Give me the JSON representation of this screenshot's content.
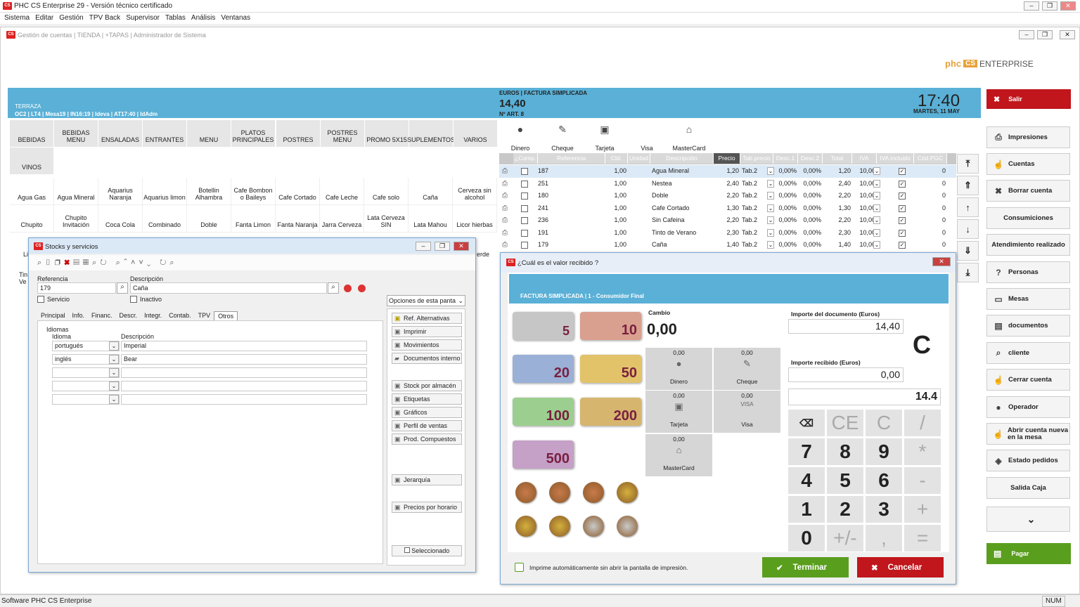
{
  "app": {
    "title": "PHC CS Enterprise 29 - Versión técnico certificado",
    "menu": [
      "Sistema",
      "Editar",
      "Gestión",
      "TPV Back",
      "Supervisor",
      "Tablas",
      "Análisis",
      "Ventanas"
    ],
    "status": "Software PHC CS Enterprise",
    "num": "NUM"
  },
  "inner": {
    "title": "Gestión de cuentas | TIENDA | +TAPAS | Administrador de Sistema",
    "brand": "phc CS ENTERPRISE"
  },
  "header": {
    "area": "TERRAZA",
    "info": "OC2 | LT4 | Mesa19 | IN16:19 | Ideva | AT17:40 | IdAdm",
    "doc": "EUROS | FACTURA SIMPLICADA",
    "total": "14,40",
    "nart": "Nº ART. 8",
    "time": "17:40",
    "date": "MARTES, 11 MAY"
  },
  "categories": [
    "BEBIDAS",
    "BEBIDAS MENU",
    "ENSALADAS",
    "ENTRANTES",
    "MENU",
    "PLATOS PRINCIPALES",
    "POSTRES",
    "POSTRES MENU",
    "PROMO 5X15",
    "SUPLEMENTOS",
    "VARIOS",
    "VINOS"
  ],
  "products": [
    "Agua Gas",
    "Agua Mineral",
    "Aquarius Naranja",
    "Aquarius limon",
    "Botellin Alhambra",
    "Cafe Bombon o Baileys",
    "Cafe Cortado",
    "Cafe Leche",
    "Cafe solo",
    "Caña",
    "Cerveza sin alcohol",
    "Chupito",
    "Chupito Invitación",
    "Coca Cola",
    "Combinado",
    "Doble",
    "Fanta Limon",
    "Fanta Naranja",
    "Jarra Cerveza",
    "Lata Cerveza SIN",
    "Lata Mahou",
    "Licor hierbas"
  ],
  "products_partial": [
    "Li",
    "Tin Ve",
    "erde"
  ],
  "payments": [
    "Dinero",
    "Cheque",
    "Tarjeta",
    "Visa",
    "MasterCard"
  ],
  "table": {
    "headers": [
      "",
      "¿Comp.",
      "Referencia",
      "Ctd.",
      "Unidad",
      "Descripción",
      "Precio",
      "Tab.precio",
      "Desc.1",
      "Desc.2",
      "Total",
      "IVA",
      "IVA incluido",
      "Cód.PGC"
    ],
    "rows": [
      [
        "187",
        "1,00",
        "Agua Mineral",
        "1,20",
        "Tab.2",
        "0,00%",
        "0,00%",
        "1,20",
        "10,00",
        "0"
      ],
      [
        "251",
        "1,00",
        "Nestea",
        "2,40",
        "Tab.2",
        "0,00%",
        "0,00%",
        "2,40",
        "10,00",
        "0"
      ],
      [
        "180",
        "1,00",
        "Doble",
        "2,20",
        "Tab.2",
        "0,00%",
        "0,00%",
        "2,20",
        "10,00",
        "0"
      ],
      [
        "241",
        "1,00",
        "Cafe Cortado",
        "1,30",
        "Tab.2",
        "0,00%",
        "0,00%",
        "1,30",
        "10,00",
        "0"
      ],
      [
        "236",
        "1,00",
        "Sin Cafeina",
        "2,20",
        "Tab.2",
        "0,00%",
        "0,00%",
        "2,20",
        "10,00",
        "0"
      ],
      [
        "191",
        "1,00",
        "Tinto de Verano",
        "2,30",
        "Tab.2",
        "0,00%",
        "0,00%",
        "2,30",
        "10,00",
        "0"
      ],
      [
        "179",
        "1,00",
        "Caña",
        "1,40",
        "Tab.2",
        "0,00%",
        "0,00%",
        "1,40",
        "10,00",
        "0"
      ]
    ]
  },
  "right": {
    "salir": "Salir",
    "buttons": [
      "Impresiones",
      "Cuentas",
      "Borrar cuenta",
      "Consumiciones",
      "Atendimiento realizado",
      "Personas",
      "Mesas",
      "documentos",
      "cliente",
      "Cerrar cuenta",
      "Operador",
      "Abrir cuenta nueva en la mesa",
      "Estado pedidos",
      "Salida Caja"
    ],
    "pagar": "Pagar"
  },
  "stocks": {
    "title": "Stocks y servicios",
    "ref_label": "Referencia",
    "ref": "179",
    "desc_label": "Descripción",
    "desc": "Caña",
    "servicio": "Servicio",
    "inactivo": "Inactivo",
    "tabs": [
      "Principal",
      "Info.",
      "Financ.",
      "Descr.",
      "Integr.",
      "Contab.",
      "TPV",
      "Otros"
    ],
    "idiomas": "Idiomas",
    "col_idioma": "Idioma",
    "col_desc": "Descripción",
    "langs": [
      [
        "portugués",
        "Imperial"
      ],
      [
        "inglés",
        "Bear"
      ]
    ],
    "opciones": "Opciones de esta panta",
    "options": [
      "Ref. Alternativas",
      "Imprimir",
      "Movimientos",
      "Documentos interno",
      "Stock por almacén",
      "Etiquetas",
      "Gráficos",
      "Perfil de ventas",
      "Prod. Compuestos",
      "Jerarquía",
      "Precios por horario"
    ],
    "seleccionado": "Seleccionado"
  },
  "pay": {
    "title": "¿Cuál es el valor recibido ?",
    "band": "FACTURA SIMPLICADA | 1 - Consumidor Final",
    "cambio_label": "Cambio",
    "cambio": "0,00",
    "importe_doc_label": "Importe del documento (Euros)",
    "importe_doc": "14,40",
    "importe_rec_label": "Importe recibido (Euros)",
    "importe_rec": "0,00",
    "display": "14.4",
    "c": "C",
    "methods": [
      {
        "amt": "0,00",
        "name": "Dinero"
      },
      {
        "amt": "0,00",
        "name": "Cheque"
      },
      {
        "amt": "0,00",
        "name": "Tarjeta"
      },
      {
        "amt": "0,00",
        "name": "Visa"
      },
      {
        "amt": "0,00",
        "name": "MasterCard"
      }
    ],
    "notes": [
      "5",
      "10",
      "20",
      "50",
      "100",
      "200",
      "500"
    ],
    "keys": [
      "⌫",
      "CE",
      "C",
      "/",
      "7",
      "8",
      "9",
      "*",
      "4",
      "5",
      "6",
      "-",
      "1",
      "2",
      "3",
      "+",
      "0",
      "+/-",
      ",",
      "="
    ],
    "imprime": "Imprime automáticamente sin abrir la pantalla de impresión.",
    "terminar": "Terminar",
    "cancelar": "Cancelar"
  },
  "colors": {
    "blue": "#5ab0d6",
    "red": "#c0161c",
    "green": "#5a9e1e"
  }
}
